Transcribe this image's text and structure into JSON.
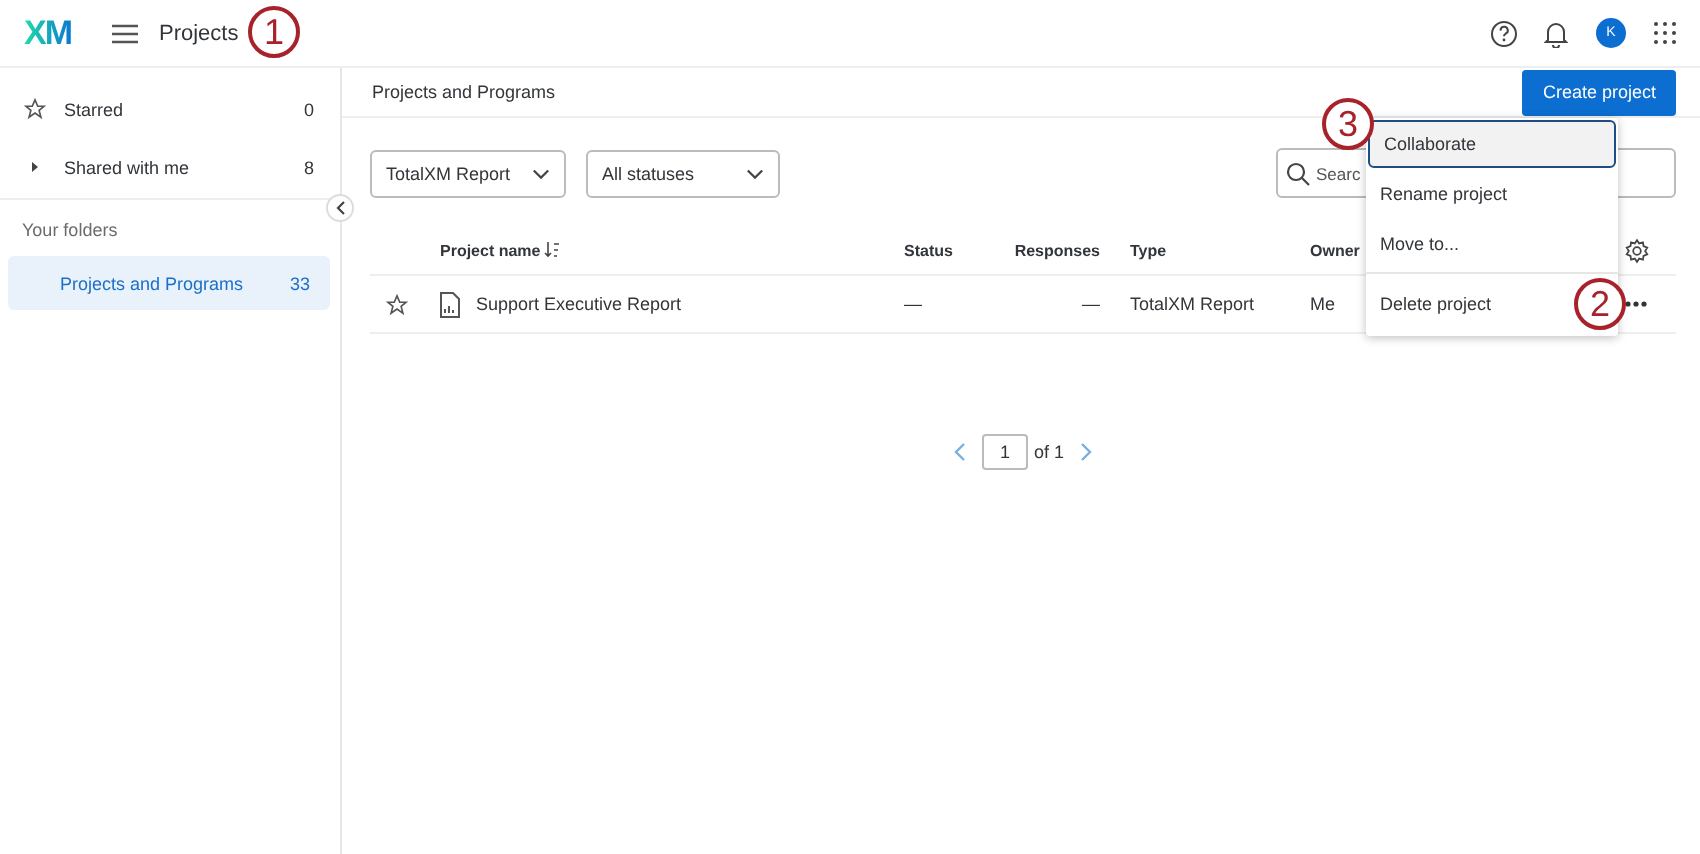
{
  "header": {
    "logo": "XM",
    "title": "Projects",
    "avatar": "K"
  },
  "sidebar": {
    "items": [
      {
        "label": "Starred",
        "count": "0",
        "kind": "starred"
      },
      {
        "label": "Shared with me",
        "count": "8",
        "kind": "expandable"
      }
    ],
    "section_title": "Your folders",
    "folders": [
      {
        "label": "Projects and Programs",
        "count": "33",
        "selected": true
      }
    ]
  },
  "main": {
    "breadcrumb": "Projects and Programs",
    "create_button": "Create project",
    "filters": [
      {
        "value": "TotalXM Report"
      },
      {
        "value": "All statuses"
      }
    ],
    "search": {
      "placeholder": "Searc"
    },
    "table": {
      "columns": [
        "Project name",
        "Status",
        "Responses",
        "Type",
        "Owner"
      ],
      "rows": [
        {
          "starred": false,
          "cells": [
            "Support Executive Report",
            "—",
            "—",
            "TotalXM Report",
            "Me"
          ]
        }
      ]
    },
    "pagination": {
      "page": "1",
      "of": "of 1"
    }
  },
  "context_menu": {
    "items": [
      {
        "label": "Collaborate",
        "selected": true
      },
      {
        "label": "Rename project",
        "selected": false
      },
      {
        "label": "Move to...",
        "selected": false
      },
      {
        "label": "Delete project",
        "selected": false
      }
    ]
  },
  "callouts": [
    {
      "label": "1"
    },
    {
      "label": "2"
    },
    {
      "label": "3"
    }
  ]
}
